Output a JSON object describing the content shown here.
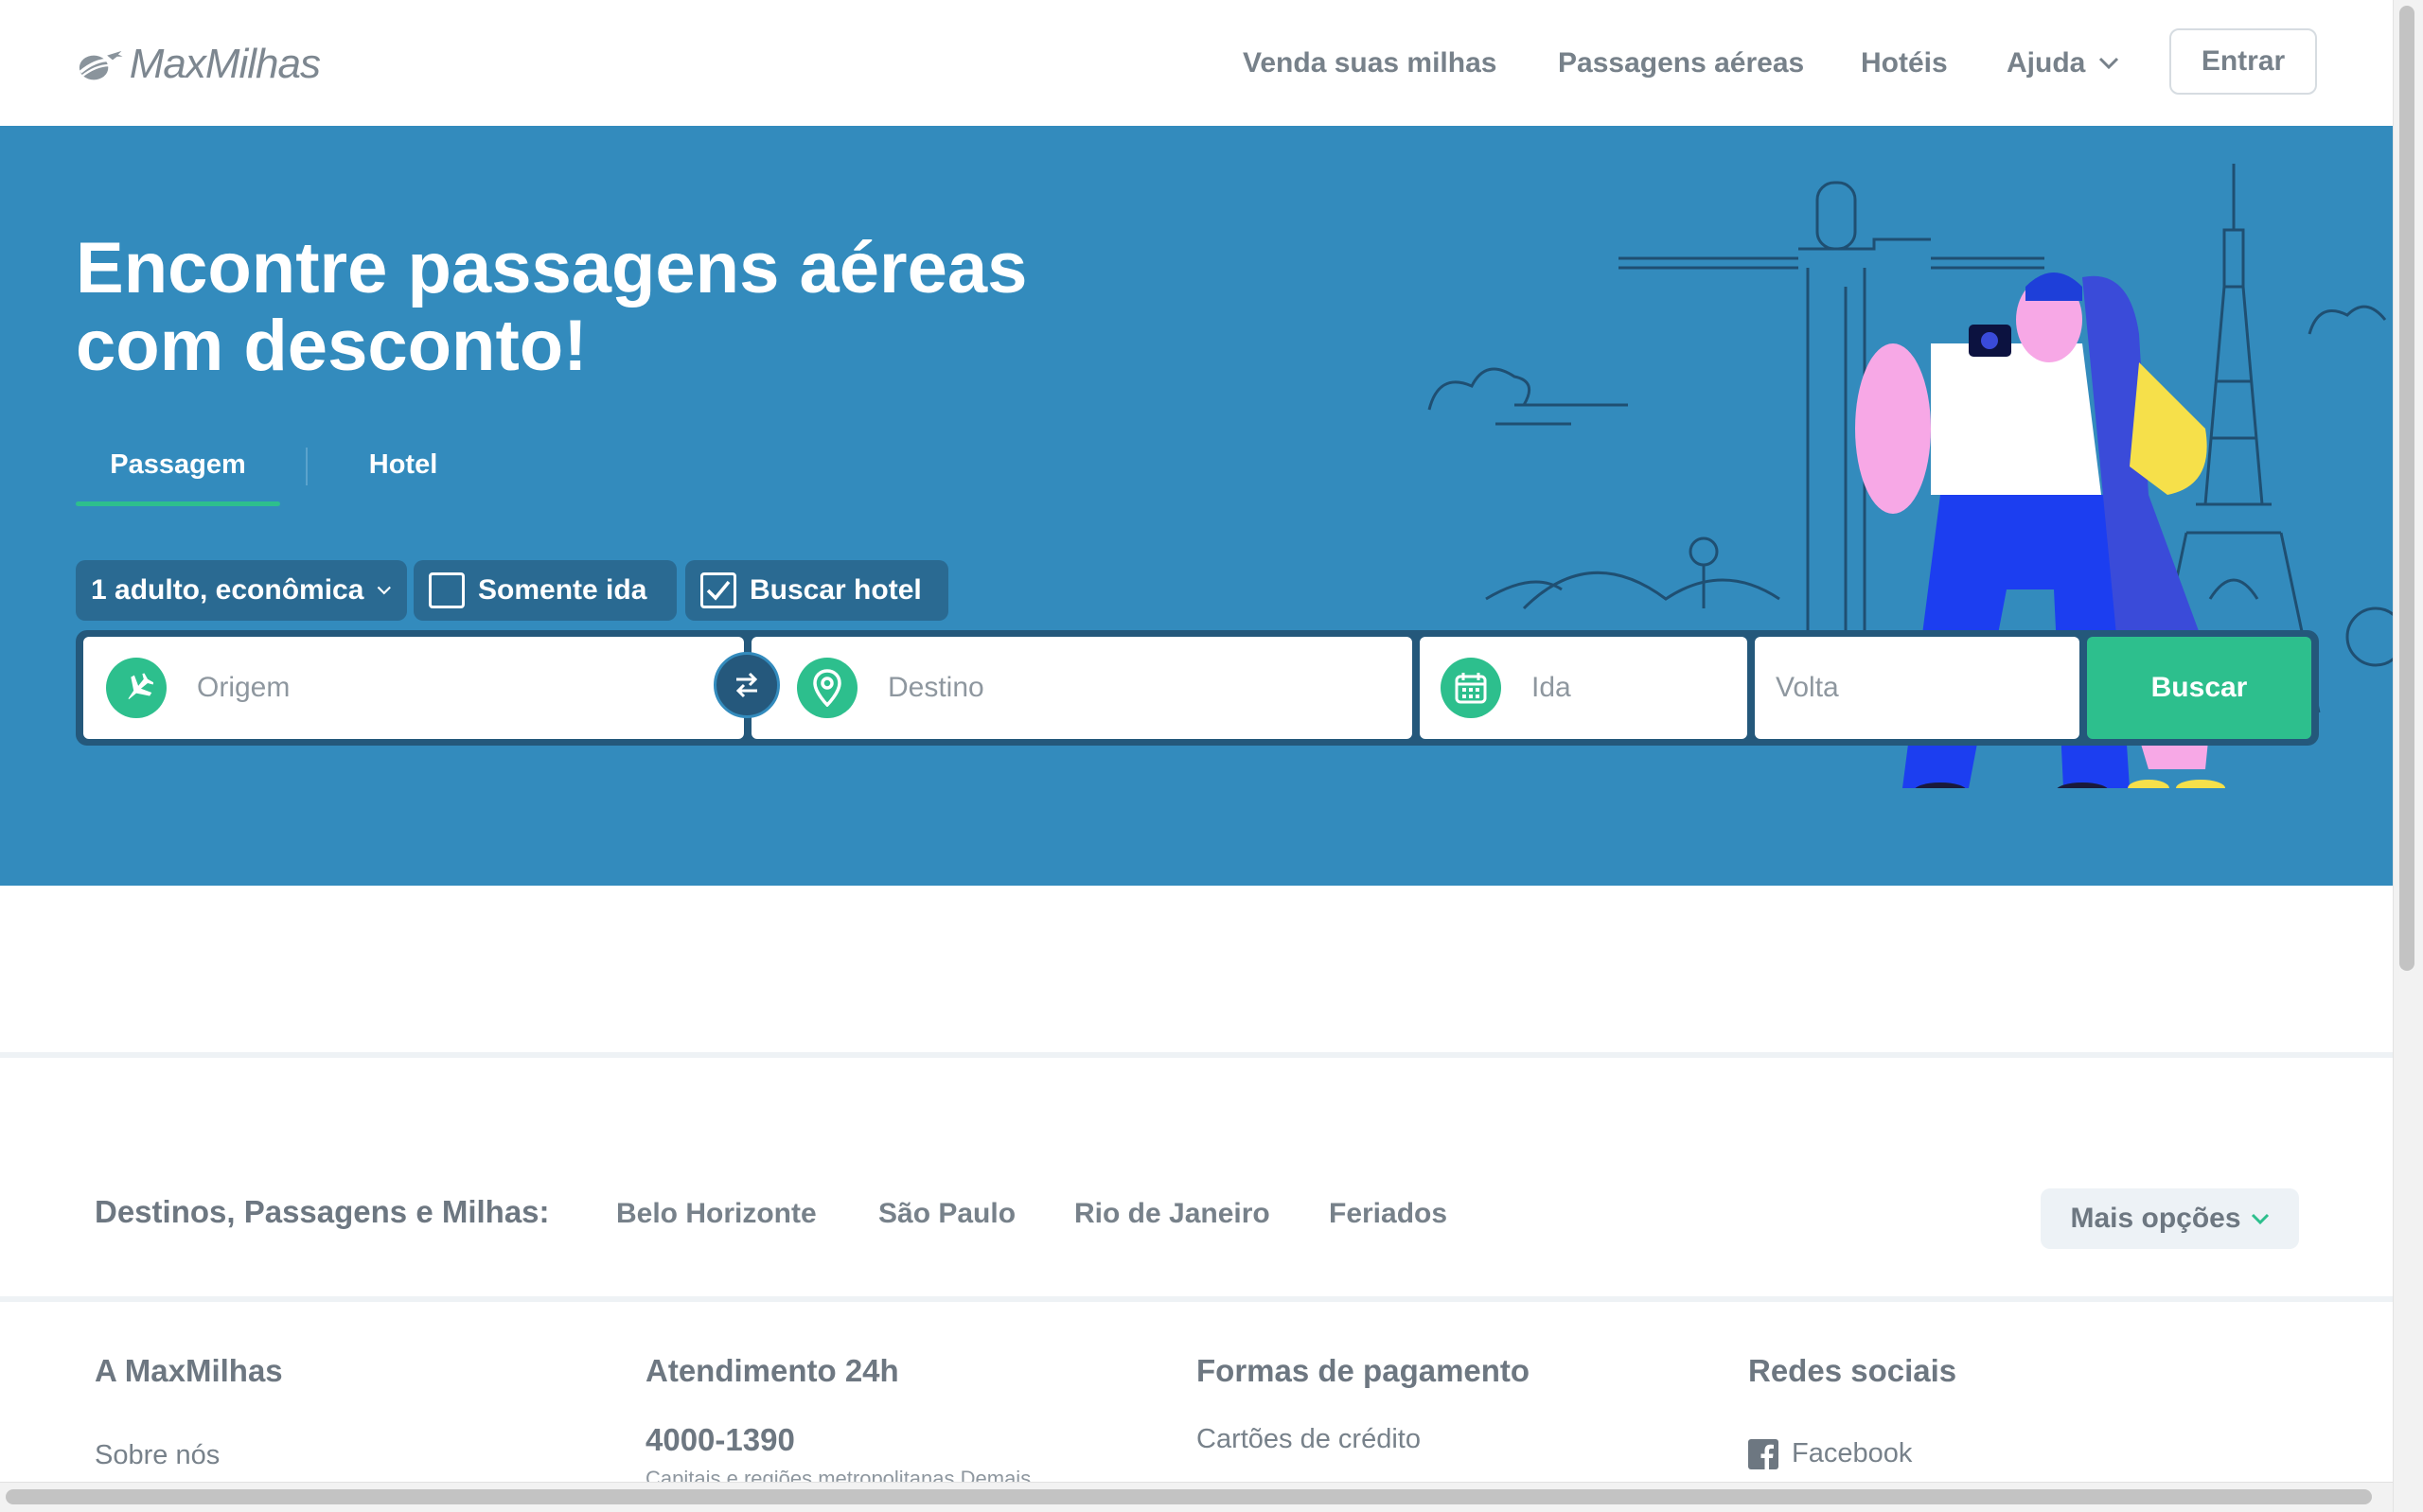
{
  "header": {
    "logo_text": "MaxMilhas",
    "nav": [
      {
        "label": "Venda suas milhas"
      },
      {
        "label": "Passagens aéreas"
      },
      {
        "label": "Hotéis"
      },
      {
        "label": "Ajuda"
      }
    ],
    "login_label": "Entrar"
  },
  "hero": {
    "title_line1": "Encontre passagens aéreas",
    "title_line2": "com desconto!",
    "tabs": [
      {
        "label": "Passagem",
        "active": true
      },
      {
        "label": "Hotel",
        "active": false
      }
    ],
    "options": {
      "passengers_label": "1 adulto, econômica",
      "one_way_label": "Somente ida",
      "one_way_checked": false,
      "hotel_label": "Buscar hotel",
      "hotel_checked": true
    },
    "search": {
      "origin_placeholder": "Origem",
      "destination_placeholder": "Destino",
      "depart_placeholder": "Ida",
      "return_placeholder": "Volta",
      "button_label": "Buscar"
    }
  },
  "destinations": {
    "label": "Destinos, Passagens e Milhas:",
    "links": [
      "Belo Horizonte",
      "São Paulo",
      "Rio de Janeiro",
      "Feriados"
    ],
    "more_label": "Mais opções"
  },
  "footer": {
    "col1": {
      "title": "A MaxMilhas",
      "link": "Sobre nós"
    },
    "col2": {
      "title": "Atendimento 24h",
      "phone": "4000-1390",
      "note": "Capitais e regiões metropolitanas Demais"
    },
    "col3": {
      "title": "Formas de pagamento",
      "link": "Cartões de crédito"
    },
    "col4": {
      "title": "Redes sociais",
      "link": "Facebook"
    }
  },
  "colors": {
    "hero_bg": "#338bbd",
    "accent_green": "#2dbf8d",
    "pill_bg": "#2a6a92",
    "text_gray": "#77818a"
  },
  "icons": [
    "plane-icon",
    "swap-icon",
    "location-pin-icon",
    "calendar-icon",
    "chevron-down-icon",
    "checkbox-icon",
    "facebook-icon",
    "logo-plane-icon"
  ]
}
